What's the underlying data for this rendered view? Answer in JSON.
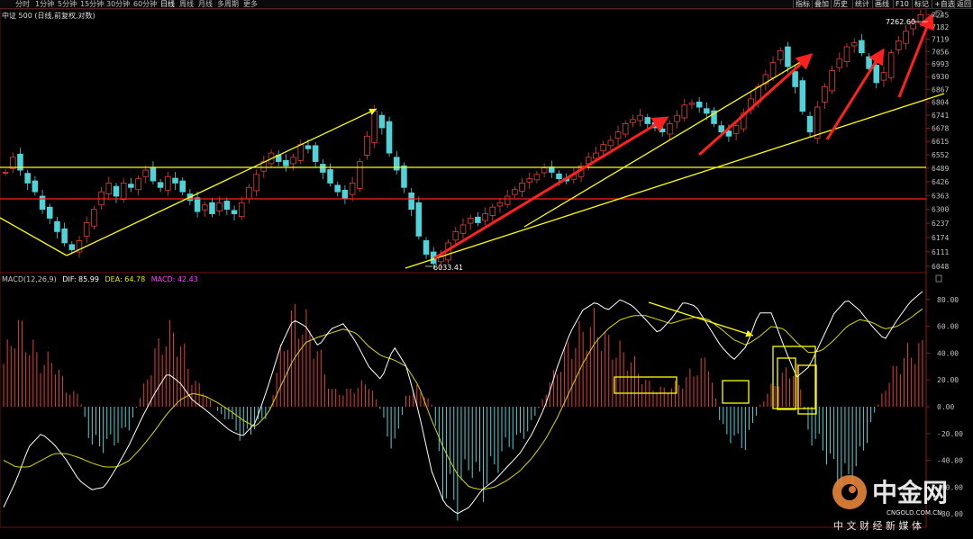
{
  "toolbar": {
    "tabs": [
      "分时",
      "1分钟",
      "5分钟",
      "15分钟",
      "30分钟",
      "60分钟",
      "日线",
      "周线",
      "月线",
      "多周期",
      "更多"
    ],
    "active_tab": "日线",
    "right_tabs": [
      "指标",
      "叠加",
      "历史",
      "统计",
      "画线",
      "F10",
      "标记",
      "+自选",
      "返回"
    ]
  },
  "instrument": {
    "title": "中证 500 (日线,前复权,对数)"
  },
  "price_labels": {
    "high": "7262.60",
    "low": "6033.41"
  },
  "macd_legend": {
    "name": "MACD(12,26,9)",
    "dif": "DIF: 85.99",
    "dea": "DEA: 64.78",
    "macd": "MACD: 42.43",
    "colors": {
      "name": "#c8c8c8",
      "dif": "#ffffff",
      "dea": "#e8e800",
      "macd": "#ff44ff"
    }
  },
  "watermark": {
    "brand": "中金网",
    "domain": "CNGOLD.COM.CN",
    "slogan": "中 文 财 经 新 媒 体"
  },
  "colors": {
    "up": "#e0413a",
    "down": "#4fd3d9",
    "annotation_yellow": "#ffff00",
    "annotation_red": "#ff2020",
    "background": "#000000"
  },
  "chart_data": [
    {
      "type": "candlestick",
      "title": "中证 500 (日线,前复权,对数)",
      "yscale": "log",
      "y_ticks": [
        "7245",
        "7182",
        "7119",
        "7056",
        "6993",
        "6930",
        "6867",
        "6804",
        "6741",
        "6678",
        "6615",
        "6552",
        "6489",
        "6426",
        "6363",
        "6300",
        "6237",
        "6174",
        "6111",
        "6048"
      ],
      "ylim": [
        6020,
        7275
      ],
      "marked_high": 7262.6,
      "marked_low": 6033.41,
      "close_path": [
        6470,
        6540,
        6480,
        6420,
        6380,
        6300,
        6260,
        6200,
        6150,
        6120,
        6160,
        6240,
        6300,
        6380,
        6420,
        6360,
        6420,
        6400,
        6440,
        6480,
        6430,
        6400,
        6450,
        6420,
        6380,
        6340,
        6290,
        6320,
        6280,
        6330,
        6300,
        6280,
        6330,
        6400,
        6460,
        6520,
        6560,
        6520,
        6500,
        6540,
        6600,
        6580,
        6520,
        6470,
        6420,
        6380,
        6350,
        6420,
        6520,
        6640,
        6760,
        6680,
        6560,
        6480,
        6400,
        6300,
        6180,
        6100,
        6060,
        6090,
        6150,
        6200,
        6230,
        6260,
        6240,
        6280,
        6310,
        6330,
        6360,
        6390,
        6420,
        6440,
        6460,
        6490,
        6470,
        6440,
        6430,
        6460,
        6500,
        6540,
        6560,
        6600,
        6620,
        6660,
        6700,
        6720,
        6740,
        6700,
        6680,
        6660,
        6700,
        6740,
        6790,
        6800,
        6780,
        6750,
        6700,
        6660,
        6640,
        6690,
        6750,
        6820,
        6880,
        6940,
        7000,
        7060,
        6980,
        6880,
        6760,
        6660,
        6780,
        6880,
        6960,
        7020,
        7080,
        7100,
        7050,
        6970,
        6900,
        6950,
        7050,
        7110,
        7160,
        7210,
        7245
      ]
    },
    {
      "type": "macd",
      "series_legend": [
        "DIF",
        "DEA",
        "MACD"
      ],
      "y_ticks": [
        "80.00",
        "60.00",
        "40.00",
        "20.00",
        "0.00",
        "-20.00",
        "-40.00",
        "-60.00",
        "-80.00"
      ],
      "ylim": [
        -90,
        92
      ],
      "dif_path": [
        -75,
        -55,
        -30,
        -20,
        -28,
        -40,
        -55,
        -62,
        -60,
        -45,
        -28,
        -8,
        10,
        25,
        18,
        5,
        -2,
        -10,
        -18,
        -22,
        -12,
        15,
        45,
        65,
        60,
        45,
        58,
        62,
        48,
        30,
        20,
        45,
        30,
        -5,
        -48,
        -72,
        -80,
        -75,
        -62,
        -55,
        -45,
        -35,
        -20,
        0,
        30,
        55,
        72,
        78,
        72,
        80,
        75,
        65,
        55,
        65,
        78,
        75,
        60,
        45,
        35,
        45,
        70,
        70,
        45,
        22,
        30,
        50,
        70,
        80,
        72,
        60,
        50,
        65,
        78,
        86
      ],
      "dea_path": [
        -40,
        -45,
        -45,
        -40,
        -35,
        -35,
        -38,
        -42,
        -45,
        -45,
        -40,
        -30,
        -18,
        -5,
        5,
        10,
        8,
        3,
        -3,
        -10,
        -15,
        -5,
        15,
        35,
        48,
        52,
        55,
        58,
        55,
        45,
        38,
        35,
        30,
        15,
        -10,
        -32,
        -50,
        -60,
        -62,
        -60,
        -55,
        -48,
        -38,
        -25,
        -8,
        12,
        32,
        48,
        58,
        65,
        68,
        68,
        65,
        62,
        65,
        67,
        65,
        58,
        50,
        46,
        52,
        60,
        58,
        48,
        40,
        42,
        50,
        60,
        65,
        63,
        58,
        60,
        66,
        73
      ],
      "hist_path": [
        32,
        60,
        46,
        32,
        34,
        12,
        8,
        -28,
        -28,
        -24,
        -14,
        10,
        38,
        54,
        48,
        20,
        10,
        -4,
        -10,
        -24,
        -14,
        -6,
        38,
        66,
        60,
        40,
        12,
        10,
        14,
        18,
        -4,
        -34,
        10,
        14,
        2,
        -64,
        -70,
        -40,
        -60,
        -44,
        -28,
        -24,
        -12,
        10,
        28,
        44,
        54,
        60,
        46,
        40,
        32,
        18,
        12,
        14,
        18,
        28,
        34,
        -16,
        -24,
        -28,
        0,
        14,
        24,
        28,
        -22,
        -28,
        -48,
        -56,
        -40,
        -10,
        14,
        30,
        40,
        42
      ]
    }
  ]
}
